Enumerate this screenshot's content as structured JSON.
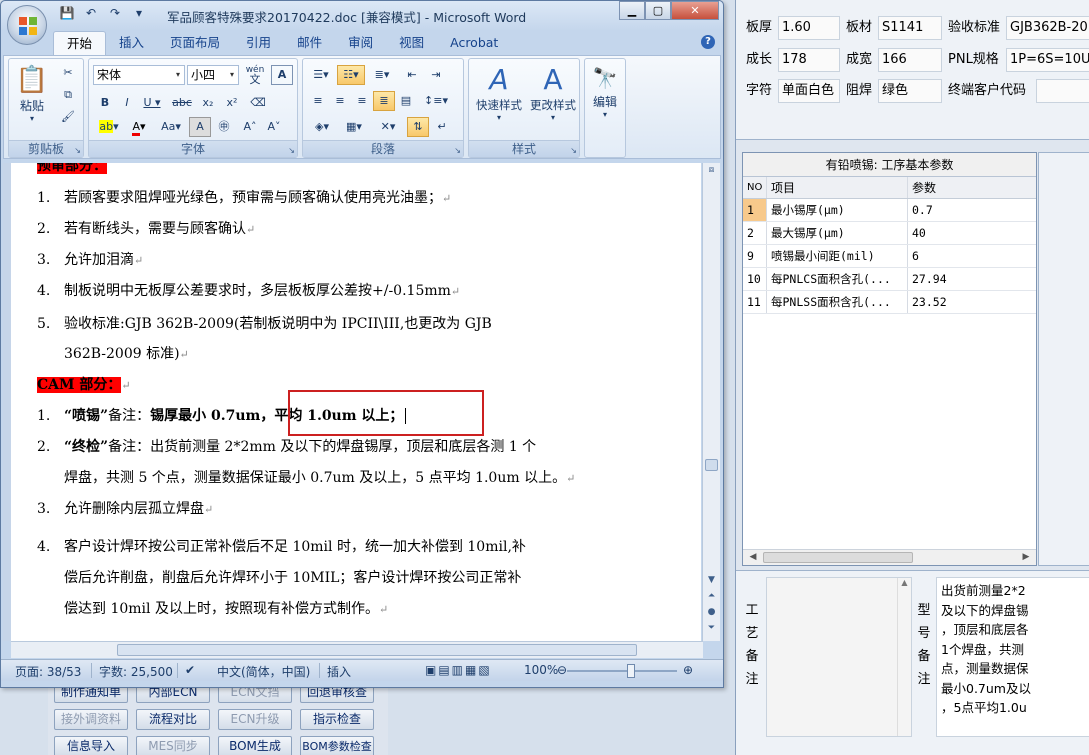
{
  "word": {
    "title": "军品顾客特殊要求20170422.doc [兼容模式] - Microsoft Word",
    "tabs": [
      "开始",
      "插入",
      "页面布局",
      "引用",
      "邮件",
      "审阅",
      "视图",
      "Acrobat"
    ],
    "ribbon": {
      "clipboard": {
        "paste": "粘贴",
        "label": "剪贴板"
      },
      "font": {
        "name": "宋体",
        "size": "小四",
        "label": "字体",
        "wen": "wén",
        "A": "A"
      },
      "paragraph": {
        "label": "段落"
      },
      "styles": {
        "quick": "快速样式",
        "change": "更改样式",
        "label": "样式"
      },
      "editing": {
        "label": "编辑"
      }
    },
    "doc": {
      "top_header": "预审部分：",
      "items_a": [
        {
          "n": "1.",
          "t": "若顾客要求阻焊哑光绿色，预审需与顾客确认使用亮光油墨；"
        },
        {
          "n": "2.",
          "t": "若有断线头，需要与顾客确认"
        },
        {
          "n": "3.",
          "t": "允许加泪滴"
        },
        {
          "n": "4.",
          "t": "制板说明中无板厚公差要求时，多层板板厚公差按+/-0.15mm"
        },
        {
          "n": "5.",
          "t": "验收标准:GJB 362B-2009(若制板说明中为 IPCII\\III,也更改为 GJB"
        },
        {
          "n": "",
          "t": "362B-2009 标准)"
        }
      ],
      "cam_header": "CAM 部分：",
      "cam1": {
        "n": "1.",
        "q": "“喷锡”",
        "pre": "备注：",
        "bold": "锡厚最小 0.7um，平均 1.0um 以上；"
      },
      "cam2": {
        "n": "2.",
        "q": "“终检”",
        "t1": "备注：出货前测量 2*2mm 及以下的焊盘锡厚，顶层和底层各测 1 个",
        "t2": "焊盘，共测 5 个点，测量数据保证最小 0.7um 及以上，5 点平均 1.0um 以上。"
      },
      "cam3": {
        "n": "3.",
        "t": "允许删除内层孤立焊盘"
      },
      "cam4": {
        "n": "4.",
        "t1": "客户设计焊环按公司正常补偿后不足 10mil 时，统一加大补偿到 10mil,补",
        "t2": "偿后允许削盘，削盘后允许焊环小于 10MIL；客户设计焊环按公司正常补",
        "t3": "偿达到 10mil 及以上时，按照现有补偿方式制作。"
      },
      "para_mark": "↵"
    },
    "status": {
      "page": "页面: 38/53",
      "words": "字数: 25,500",
      "lang": "中文(简体，中国)",
      "mode": "插入",
      "zoom": "100%"
    }
  },
  "bgapp": {
    "info": {
      "r0": [
        {
          "l": "板厚",
          "v": "1.60"
        },
        {
          "l": "板材",
          "v": "S1141"
        },
        {
          "l": "验收标准",
          "v": "GJB362B-20"
        }
      ],
      "r1": [
        {
          "l": "成长",
          "v": "178"
        },
        {
          "l": "成宽",
          "v": "166"
        },
        {
          "l": "PNL规格",
          "v": "1P=6S=10U"
        }
      ],
      "r2": [
        {
          "l": "字符",
          "v": "单面白色"
        },
        {
          "l": "阻焊",
          "v": "绿色"
        },
        {
          "l": "终端客户代码",
          "v": ""
        }
      ]
    },
    "grid": {
      "title": "有铅喷锡: 工序基本参数",
      "headers": [
        "NO",
        "项目",
        "参数"
      ],
      "rows": [
        {
          "no": "1",
          "item": "最小锡厚(μm)",
          "val": "0.7"
        },
        {
          "no": "2",
          "item": "最大锡厚(μm)",
          "val": "40"
        },
        {
          "no": "9",
          "item": "喷锡最小间距(mil)",
          "val": "6"
        },
        {
          "no": "10",
          "item": "每PNLCS面积含孔(...",
          "val": "27.94"
        },
        {
          "no": "11",
          "item": "每PNLSS面积含孔(...",
          "val": "23.52"
        }
      ]
    },
    "bottom": {
      "label1": [
        "工",
        "艺",
        "备",
        "注"
      ],
      "label2": [
        "型",
        "号",
        "备",
        "注"
      ],
      "memo": [
        "出货前测量2*2",
        "及以下的焊盘锡",
        "，顶层和底层各",
        "1个焊盘，共测",
        "点，测量数据保",
        "最小0.7um及以",
        "，5点平均1.0u"
      ]
    }
  },
  "bgbuttons": [
    {
      "t": "制作通知单",
      "d": false
    },
    {
      "t": "内部ECN",
      "d": false
    },
    {
      "t": "ECN文挡",
      "d": true
    },
    {
      "t": "回退审核查",
      "d": false
    },
    {
      "t": "接外调资料",
      "d": false
    },
    {
      "t": "流程对比",
      "d": false
    },
    {
      "t": "ECN升级",
      "d": true
    },
    {
      "t": "指示检查",
      "d": false
    },
    {
      "t": "信息导入",
      "d": false
    },
    {
      "t": "MES同步",
      "d": true
    },
    {
      "t": "BOM生成",
      "d": false
    },
    {
      "t": "BOM参数检查",
      "d": false
    }
  ]
}
